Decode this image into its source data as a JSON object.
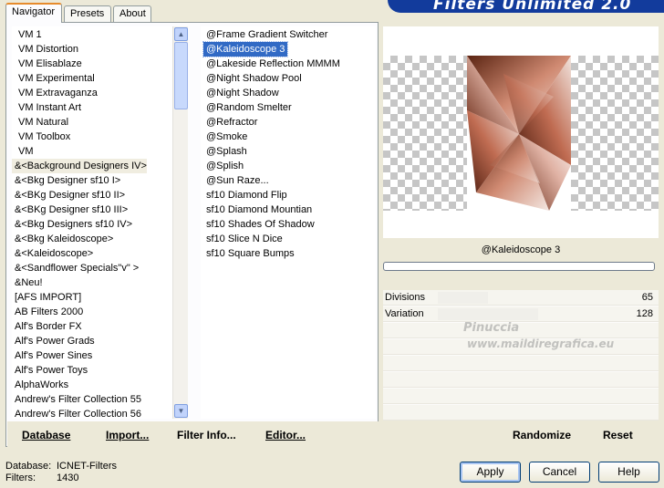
{
  "app_title": "Filters Unlimited 2.0",
  "tabs": [
    {
      "label": "Navigator"
    },
    {
      "label": "Presets"
    },
    {
      "label": "About"
    }
  ],
  "categories": [
    "VM 1",
    "VM Distortion",
    "VM Elisablaze",
    "VM Experimental",
    "VM Extravaganza",
    "VM Instant Art",
    "VM Natural",
    "VM Toolbox",
    "VM",
    "&<Background Designers IV>",
    "&<Bkg Designer sf10 I>",
    "&<BKg Designer sf10 II>",
    "&<BKg Designer sf10 III>",
    "&<Bkg Designers sf10 IV>",
    "&<Bkg Kaleidoscope>",
    "&<Kaleidoscope>",
    "&<Sandflower Specials\"v\" >",
    "&Neu!",
    "[AFS IMPORT]",
    "AB Filters 2000",
    "Alf's Border FX",
    "Alf's Power Grads",
    "Alf's Power Sines",
    "Alf's Power Toys",
    "AlphaWorks",
    "Andrew's Filter Collection 55",
    "Andrew's Filter Collection 56"
  ],
  "selected_category": "&<Background Designers IV>",
  "filters": [
    "@Frame Gradient Switcher",
    "@Kaleidoscope 3",
    "@Lakeside Reflection MMMM",
    "@Night Shadow Pool",
    "@Night Shadow",
    "@Random Smelter",
    "@Refractor",
    "@Smoke",
    "@Splash",
    "@Splish",
    "@Sun Raze...",
    "sf10 Diamond Flip",
    "sf10 Diamond Mountian",
    "sf10 Shades Of Shadow",
    "sf10 Slice N Dice",
    "sf10 Square Bumps"
  ],
  "selected_filter": "@Kaleidoscope 3",
  "toolbar": {
    "database": "Database",
    "import": "Import...",
    "filter_info": "Filter Info...",
    "editor": "Editor..."
  },
  "current_filter_name": "@Kaleidoscope 3",
  "params": [
    {
      "name": "Divisions",
      "value": "65",
      "fraction": 0.25
    },
    {
      "name": "Variation",
      "value": "128",
      "fraction": 0.5
    }
  ],
  "right_toolbar": {
    "randomize": "Randomize",
    "reset": "Reset"
  },
  "status": {
    "database_label": "Database:",
    "database_value": "ICNET-Filters",
    "filters_label": "Filters:",
    "filters_value": "1430"
  },
  "buttons": {
    "apply": "Apply",
    "cancel": "Cancel",
    "help": "Help"
  },
  "watermark": {
    "line1": "Pinuccia",
    "line2": "www.maildiregrafica.eu"
  },
  "colors": {
    "selection": "#316ac5",
    "title_bar": "#123b9c",
    "tab_accent": "#e68b2c"
  }
}
